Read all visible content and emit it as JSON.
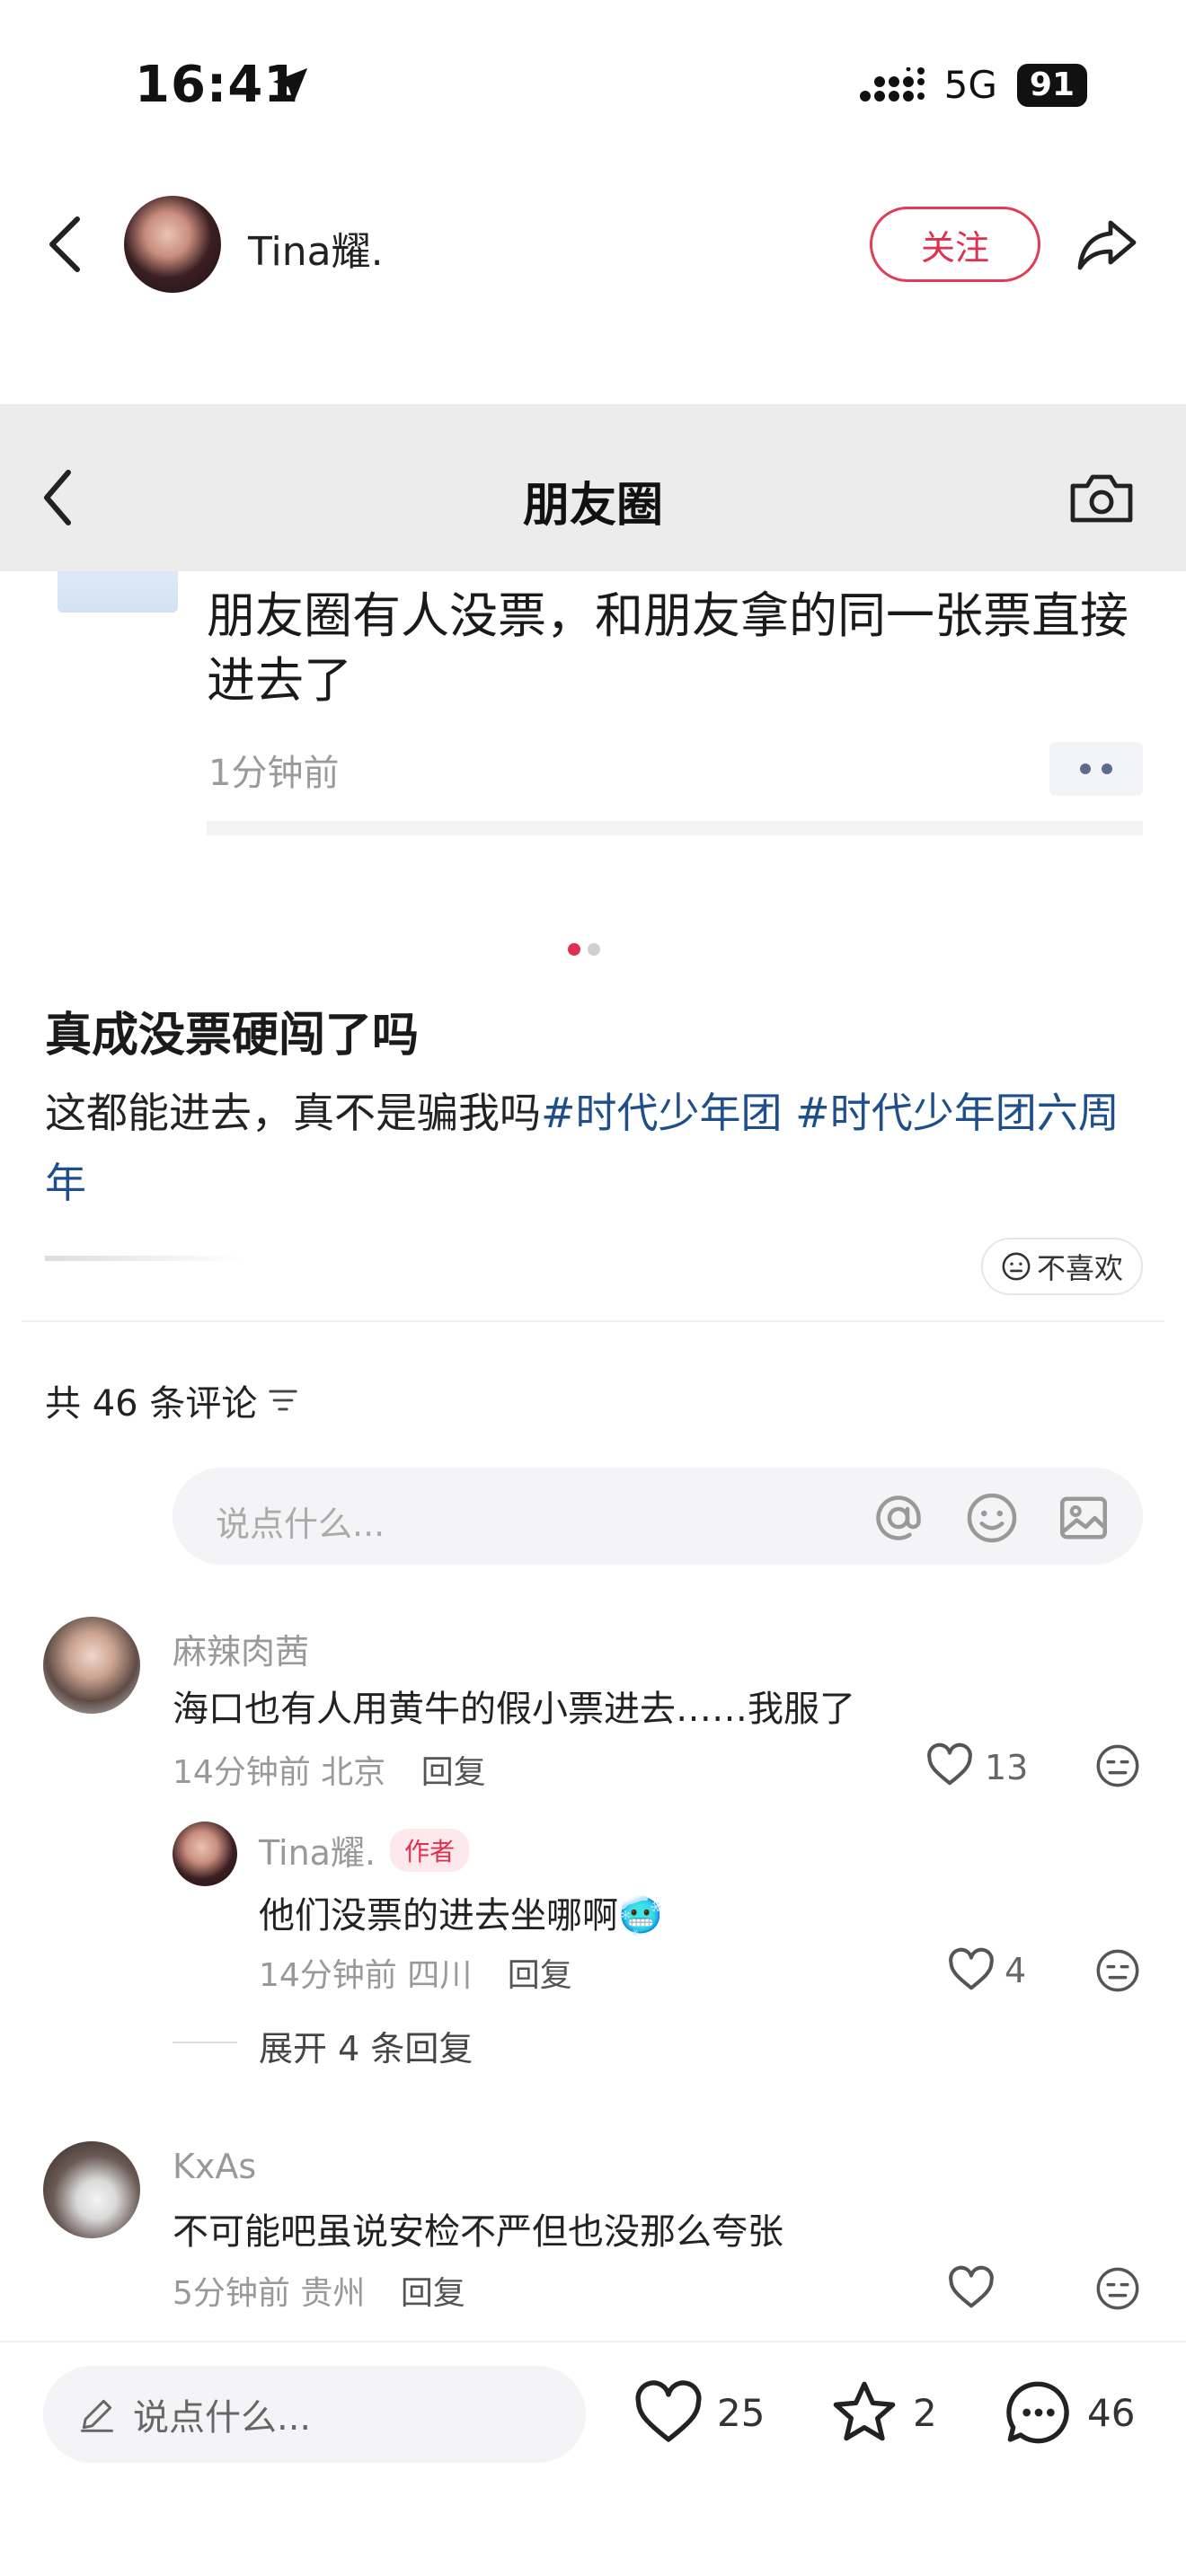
{
  "status_bar": {
    "time": "16:41",
    "network": "5G",
    "battery": "91"
  },
  "header": {
    "username": "Tina耀.",
    "follow_label": "关注"
  },
  "image_card": {
    "title": "朋友圈",
    "post_text": "朋友圈有人没票，和朋友拿的同一张票直接进去了",
    "post_time": "1分钟前"
  },
  "post": {
    "title": "真成没票硬闯了吗",
    "body": "这都能进去，真不是骗我吗",
    "tags": [
      "#时代少年团",
      "#时代少年团六周年"
    ],
    "dislike_label": "不喜欢"
  },
  "comments_header": {
    "count_label": "共 46 条评论"
  },
  "comment_input": {
    "placeholder": "说点什么..."
  },
  "comments": [
    {
      "name": "麻辣肉茜",
      "text": "海口也有人用黄牛的假小票进去……我服了",
      "time": "14分钟前",
      "location": "北京",
      "reply_label": "回复",
      "likes": "13"
    },
    {
      "name": "Tina耀.",
      "badge": "作者",
      "text": "他们没票的进去坐哪啊🥶",
      "time": "14分钟前",
      "location": "四川",
      "reply_label": "回复",
      "likes": "4"
    },
    {
      "name": "KxAs",
      "text": "不可能吧虽说安检不严但也没那么夸张",
      "time": "5分钟前",
      "location": "贵州",
      "reply_label": "回复",
      "likes": ""
    }
  ],
  "expand_replies": "展开 4 条回复",
  "bottom_bar": {
    "placeholder": "说点什么...",
    "likes": "25",
    "stars": "2",
    "comments": "46"
  },
  "colors": {
    "accent": "#e0304e",
    "tag": "#1f4f8a",
    "pager_active": "#e0304e",
    "pager_inactive": "#d0d0d0"
  }
}
